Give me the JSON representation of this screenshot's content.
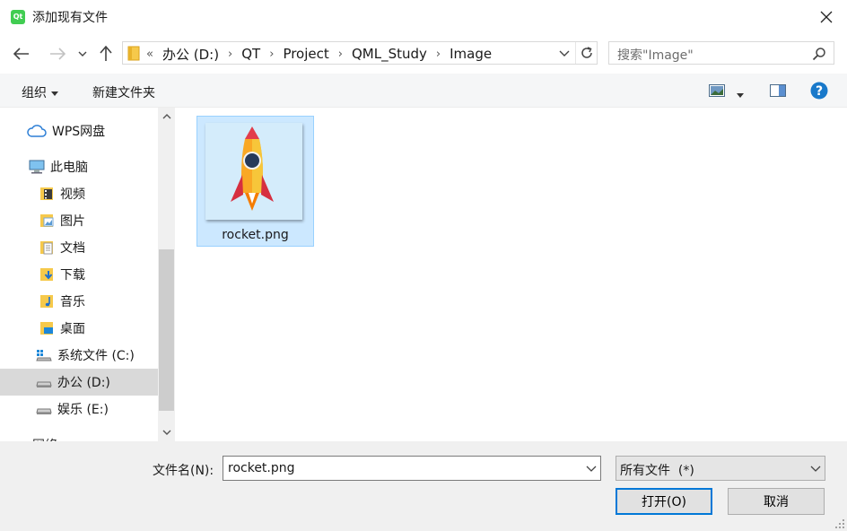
{
  "window": {
    "title": "添加现有文件",
    "app_icon_text": "Qt"
  },
  "address": {
    "overflow": "«",
    "crumbs": [
      "办公 (D:)",
      "QT",
      "Project",
      "QML_Study",
      "Image"
    ],
    "separator": "›"
  },
  "search": {
    "placeholder": "搜索\"Image\""
  },
  "toolbar": {
    "organize_label": "组织",
    "new_folder_label": "新建文件夹"
  },
  "sidebar": {
    "items": [
      {
        "label": "WPS网盘",
        "icon": "cloud-icon"
      },
      {
        "label": "此电脑",
        "icon": "computer-icon"
      },
      {
        "label": "视频",
        "icon": "video-folder-icon"
      },
      {
        "label": "图片",
        "icon": "pictures-folder-icon"
      },
      {
        "label": "文档",
        "icon": "documents-folder-icon"
      },
      {
        "label": "下载",
        "icon": "downloads-folder-icon"
      },
      {
        "label": "音乐",
        "icon": "music-folder-icon"
      },
      {
        "label": "桌面",
        "icon": "desktop-folder-icon"
      },
      {
        "label": "系统文件 (C:)",
        "icon": "system-drive-icon"
      },
      {
        "label": "办公 (D:)",
        "icon": "drive-icon",
        "selected": true
      },
      {
        "label": "娱乐 (E:)",
        "icon": "drive-icon"
      }
    ],
    "partial_item": "网络"
  },
  "files": [
    {
      "name": "rocket.png",
      "selected": true
    }
  ],
  "bottom": {
    "filename_label": "文件名(N):",
    "filename_value": "rocket.png",
    "filter_value": "所有文件  (*)",
    "open_label": "打开(O)",
    "cancel_label": "取消"
  },
  "colors": {
    "selection": "#cce8ff",
    "accent": "#0078d7",
    "help": "#1979ca"
  }
}
